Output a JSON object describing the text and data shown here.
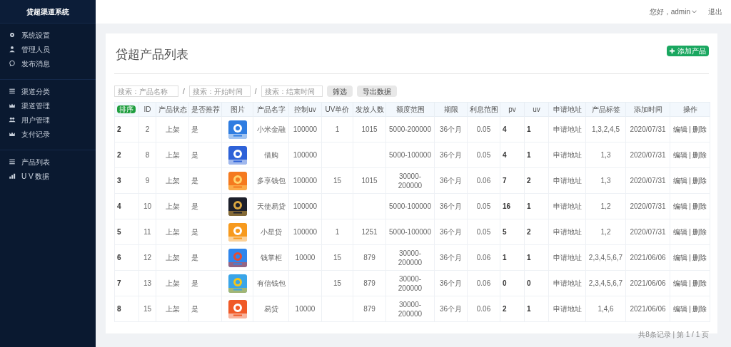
{
  "sidebar": {
    "title": "贷超渠道系统",
    "groups": [
      {
        "items": [
          {
            "label": "系统设置"
          },
          {
            "label": "管理人员"
          },
          {
            "label": "发布消息"
          }
        ]
      },
      {
        "items": [
          {
            "label": "渠道分类"
          },
          {
            "label": "渠道管理"
          },
          {
            "label": "用户管理"
          },
          {
            "label": "支付记录"
          }
        ]
      },
      {
        "items": [
          {
            "label": "产品列表"
          },
          {
            "label": "U V 数据"
          }
        ]
      }
    ]
  },
  "header": {
    "greeting": "您好，admin",
    "logout": "退出"
  },
  "page": {
    "title": "贷超产品列表",
    "add_button": "添加产品"
  },
  "filters": {
    "name_placeholder": "搜索：产品名称",
    "start_placeholder": "搜索：开始时间",
    "end_placeholder": "搜索：结束时间",
    "separators": [
      "/",
      "/"
    ],
    "buttons": [
      "筛选",
      "导出数据"
    ]
  },
  "table": {
    "columns": [
      "排序",
      "ID",
      "产品状态",
      "是否推荐",
      "图片",
      "产品名字",
      "控制uv",
      "UV单价",
      "发放人数",
      "额度范围",
      "期限",
      "利息范围",
      "pv",
      "uv",
      "申请地址",
      "产品标签",
      "添加时间",
      "操作"
    ],
    "rows": [
      {
        "cells": [
          "2",
          "2",
          "上架",
          "是",
          {
            "kind": "picture"
          },
          "小米金融",
          "100000",
          "1",
          "1015",
          "5000-200000",
          "36个月",
          "0.05",
          "4",
          "1",
          "申请地址",
          "1,3,2,4,5",
          "2020/07/31"
        ],
        "actions": {
          "edit": "编辑",
          "separator": "|",
          "delete": "删除"
        }
      },
      {
        "cells": [
          "2",
          "8",
          "上架",
          "是",
          {
            "kind": "picture"
          },
          "借购",
          "100000",
          null,
          null,
          "5000-100000",
          "36个月",
          "0.05",
          "4",
          "1",
          "申请地址",
          "1,3",
          "2020/07/31"
        ],
        "actions": {
          "edit": "编辑",
          "separator": "|",
          "delete": "删除"
        }
      },
      {
        "cells": [
          "3",
          "9",
          "上架",
          "是",
          {
            "kind": "picture"
          },
          "多享钱包",
          "100000",
          "15",
          "1015",
          "30000-200000",
          "36个月",
          "0.06",
          "7",
          "2",
          "申请地址",
          "1,3",
          "2020/07/31"
        ],
        "actions": {
          "edit": "编辑",
          "separator": "|",
          "delete": "删除"
        }
      },
      {
        "cells": [
          "4",
          "10",
          "上架",
          "是",
          {
            "kind": "picture"
          },
          "天使易贷",
          "100000",
          null,
          null,
          "5000-100000",
          "36个月",
          "0.05",
          "16",
          "1",
          "申请地址",
          "1,2",
          "2020/07/31"
        ],
        "actions": {
          "edit": "编辑",
          "separator": "|",
          "delete": "删除"
        }
      },
      {
        "cells": [
          "5",
          "11",
          "上架",
          "是",
          {
            "kind": "picture"
          },
          "小星贷",
          "100000",
          "1",
          "1251",
          "5000-100000",
          "36个月",
          "0.05",
          "5",
          "2",
          "申请地址",
          "1,2",
          "2020/07/31"
        ],
        "actions": {
          "edit": "编辑",
          "separator": "|",
          "delete": "删除"
        }
      },
      {
        "cells": [
          "6",
          "12",
          "上架",
          "是",
          {
            "kind": "picture"
          },
          "钱掌柜",
          "10000",
          "15",
          "879",
          "30000-200000",
          "36个月",
          "0.06",
          "1",
          "1",
          "申请地址",
          "2,3,4,5,6,7",
          "2021/06/06"
        ],
        "actions": {
          "edit": "编辑",
          "separator": "|",
          "delete": "删除"
        }
      },
      {
        "cells": [
          "7",
          "13",
          "上架",
          "是",
          {
            "kind": "picture"
          },
          "有信钱包",
          null,
          "15",
          "879",
          "30000-200000",
          "36个月",
          "0.06",
          "0",
          "0",
          "申请地址",
          "2,3,4,5,6,7",
          "2021/06/06"
        ],
        "actions": {
          "edit": "编辑",
          "separator": "|",
          "delete": "删除"
        }
      },
      {
        "cells": [
          "8",
          "15",
          "上架",
          "是",
          {
            "kind": "picture"
          },
          "易贷",
          "10000",
          null,
          "879",
          "30000-200000",
          "36个月",
          "0.06",
          "2",
          "1",
          "申请地址",
          "1,4,6",
          "2021/06/06"
        ],
        "actions": {
          "edit": "编辑",
          "separator": "|",
          "delete": "删除"
        }
      }
    ]
  },
  "pagination": "共8条记录 | 第 1 / 1 页"
}
